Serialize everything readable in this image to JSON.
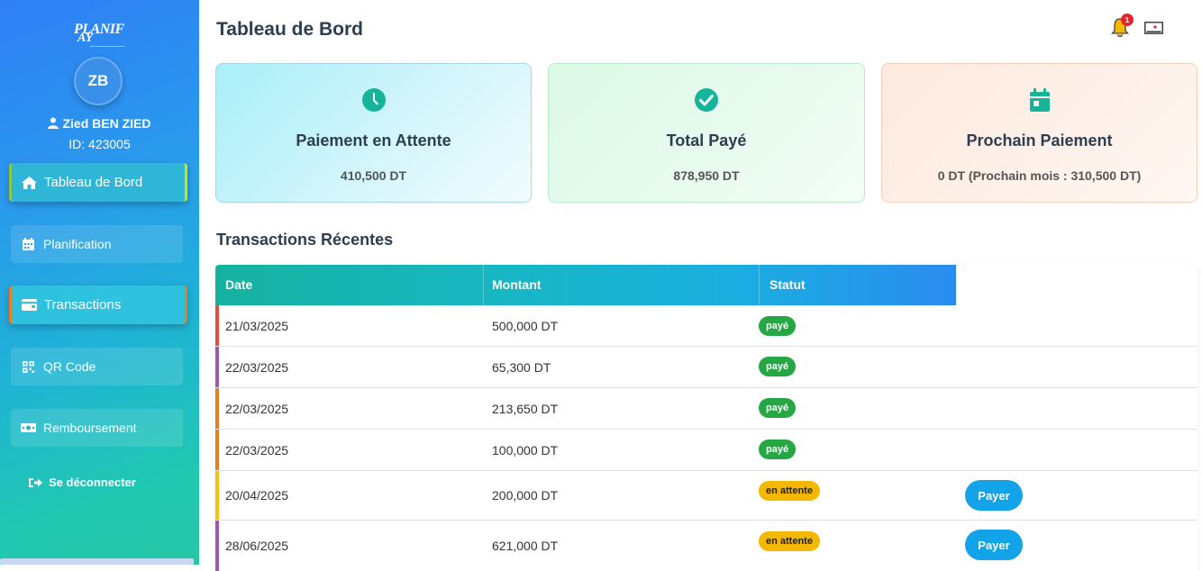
{
  "sidebar": {
    "logo_top": "LANIF",
    "logo_mid": "AY",
    "logo_p": "P",
    "avatar_initials": "ZB",
    "user_name": "Zied BEN ZIED",
    "user_id": "ID: 423005",
    "items": [
      {
        "label": "Tableau de Bord",
        "icon": "home-icon"
      },
      {
        "label": "Planification",
        "icon": "calendar-icon"
      },
      {
        "label": "Transactions",
        "icon": "wallet-icon"
      },
      {
        "label": "QR Code",
        "icon": "qrcode-icon"
      },
      {
        "label": "Remboursement",
        "icon": "money-icon"
      }
    ],
    "logout_label": "Se déconnecter"
  },
  "header": {
    "title": "Tableau de Bord",
    "notification_count": "1"
  },
  "cards": [
    {
      "title": "Paiement en Attente",
      "value": "410,500 DT",
      "icon": "clock-icon",
      "icon_color": "#16b59b"
    },
    {
      "title": "Total Payé",
      "value": "878,950 DT",
      "icon": "check-circle-icon",
      "icon_color": "#16b59b"
    },
    {
      "title": "Prochain Paiement",
      "value": "0 DT (Prochain mois : 310,500 DT)",
      "icon": "calendar-icon",
      "icon_color": "#16b59b"
    }
  ],
  "transactions": {
    "title": "Transactions Récentes",
    "columns": [
      "Date",
      "Montant",
      "Statut"
    ],
    "rows": [
      {
        "date": "21/03/2025",
        "amount": "500,000 DT",
        "status": "payé",
        "bar_color": "#e74c3c"
      },
      {
        "date": "22/03/2025",
        "amount": "65,300 DT",
        "status": "payé",
        "bar_color": "#9b59b6"
      },
      {
        "date": "22/03/2025",
        "amount": "213,650 DT",
        "status": "payé",
        "bar_color": "#e67e22"
      },
      {
        "date": "22/03/2025",
        "amount": "100,000 DT",
        "status": "payé",
        "bar_color": "#e67e22"
      },
      {
        "date": "20/04/2025",
        "amount": "200,000 DT",
        "status": "en attente",
        "bar_color": "#f1c40f",
        "action": "Payer"
      },
      {
        "date": "28/06/2025",
        "amount": "621,000 DT",
        "status": "en attente",
        "bar_color": "#9b59b6",
        "action": "Payer"
      }
    ]
  },
  "colors": {
    "paid": "#27a744",
    "pending": "#f5b800",
    "accent": "#12a3e8"
  }
}
